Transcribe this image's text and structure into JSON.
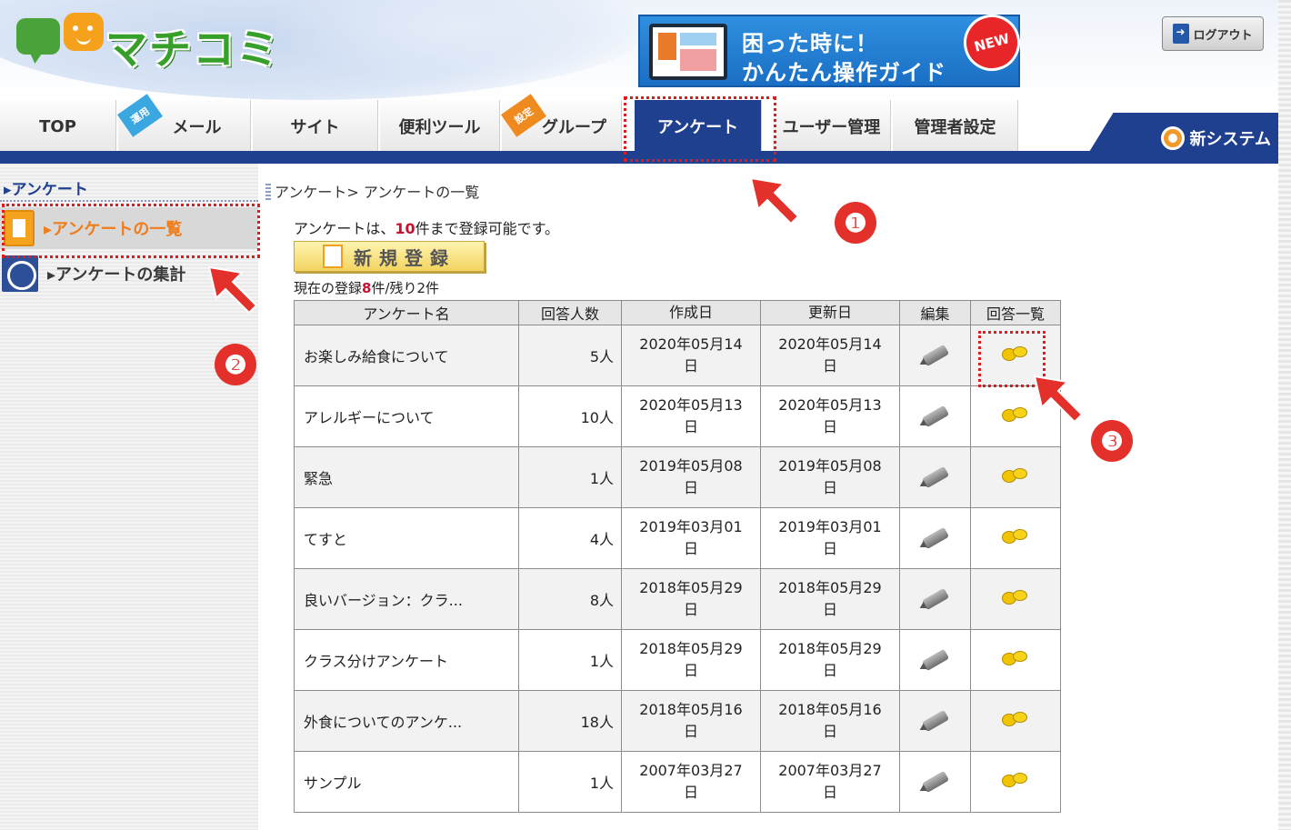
{
  "header": {
    "logo_text": "マチコミ",
    "guide_line1": "困った時に！",
    "guide_line2": "かんたん操作ガイド",
    "guide_badge": "NEW",
    "logout_label": "ログアウト"
  },
  "nav": {
    "tabs": [
      {
        "label": "TOP"
      },
      {
        "label": "メール",
        "ribbon": "運用"
      },
      {
        "label": "サイト"
      },
      {
        "label": "便利ツール"
      },
      {
        "label": "グループ",
        "ribbon": "設定"
      },
      {
        "label": "アンケート",
        "active": true
      },
      {
        "label": "ユーザー管理"
      },
      {
        "label": "管理者設定"
      }
    ],
    "new_system_label": "新システム"
  },
  "sidebar": {
    "title": "アンケート",
    "items": [
      {
        "label": "アンケートの一覧",
        "active": true
      },
      {
        "label": "アンケートの集計"
      }
    ]
  },
  "main": {
    "breadcrumb": "アンケート> アンケートの一覧",
    "limit_prefix": "アンケートは、",
    "limit_count": "10",
    "limit_suffix": "件まで登録可能です。",
    "new_button_label": "新規登録",
    "count_prefix": "現在の登録",
    "count_value": "8",
    "count_suffix": "件/残り2件"
  },
  "table": {
    "headers": [
      "アンケート名",
      "回答人数",
      "作成日",
      "更新日",
      "編集",
      "回答一覧"
    ],
    "rows": [
      {
        "name": "お楽しみ給食について",
        "count": "5人",
        "created": "2020年05月14",
        "created2": "日",
        "updated": "2020年05月14",
        "updated2": "日"
      },
      {
        "name": "アレルギーについて",
        "count": "10人",
        "created": "2020年05月13",
        "created2": "日",
        "updated": "2020年05月13",
        "updated2": "日"
      },
      {
        "name": "緊急",
        "count": "1人",
        "created": "2019年05月08",
        "created2": "日",
        "updated": "2019年05月08",
        "updated2": "日"
      },
      {
        "name": "てすと",
        "count": "4人",
        "created": "2019年03月01",
        "created2": "日",
        "updated": "2019年03月01",
        "updated2": "日"
      },
      {
        "name": "良いバージョン：クラ...",
        "count": "8人",
        "created": "2018年05月29",
        "created2": "日",
        "updated": "2018年05月29",
        "updated2": "日"
      },
      {
        "name": "クラス分けアンケート",
        "count": "1人",
        "created": "2018年05月29",
        "created2": "日",
        "updated": "2018年05月29",
        "updated2": "日"
      },
      {
        "name": "外食についてのアンケ...",
        "count": "18人",
        "created": "2018年05月16",
        "created2": "日",
        "updated": "2018年05月16",
        "updated2": "日"
      },
      {
        "name": "サンプル",
        "count": "1人",
        "created": "2007年03月27",
        "created2": "日",
        "updated": "2007年03月27",
        "updated2": "日"
      }
    ]
  },
  "annotations": {
    "step1": "❶",
    "step2": "❷",
    "step3": "❸",
    "color": "#e3302a"
  }
}
